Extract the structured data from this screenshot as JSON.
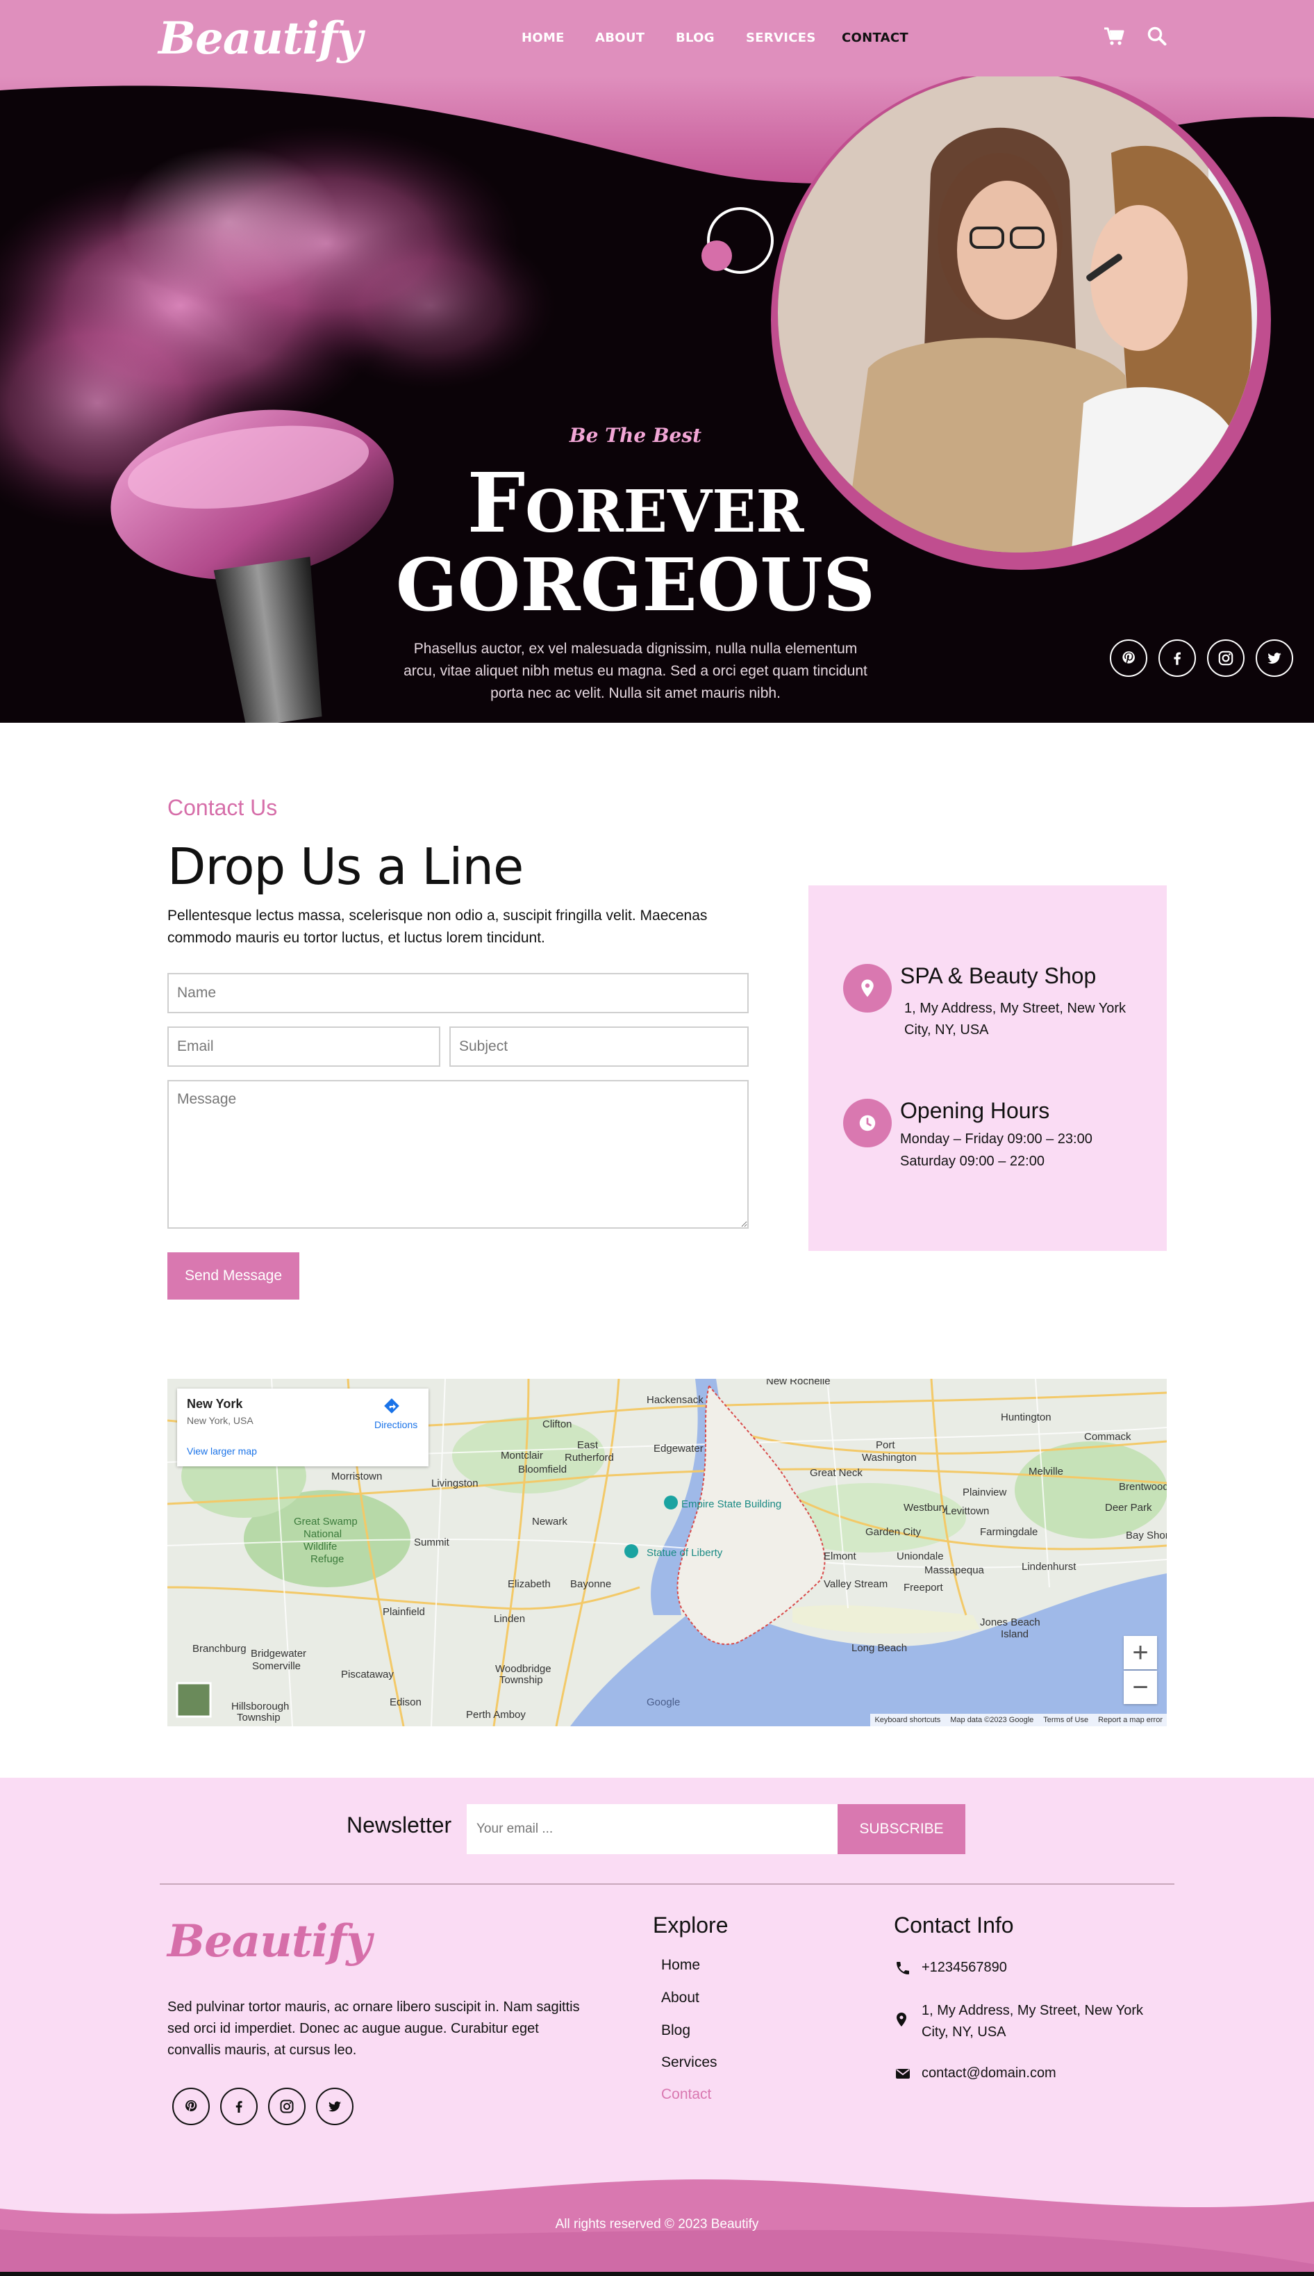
{
  "header": {
    "logo": "Beautify",
    "nav": [
      "HOME",
      "ABOUT",
      "BLOG",
      "SERVICES",
      "CONTACT"
    ],
    "active_nav": "CONTACT",
    "icons": [
      "cart-icon",
      "search-icon"
    ]
  },
  "hero": {
    "tagline": "Be The Best",
    "title_line1": "Forever",
    "title_line2": "GORGEOUS",
    "description": "Phasellus auctor, ex vel malesuada dignissim, nulla nulla elementum arcu, vitae aliquet nibh metus eu magna. Sed a orci eget quam tincidunt porta nec ac velit. Nulla sit amet mauris nibh.",
    "social": [
      "pinterest-icon",
      "facebook-icon",
      "instagram-icon",
      "twitter-icon"
    ]
  },
  "contact": {
    "label": "Contact Us",
    "heading": "Drop Us a Line",
    "description": "Pellentesque lectus massa, scelerisque non odio a, suscipit fringilla velit. Maecenas commodo mauris eu tortor luctus, et luctus lorem tincidunt.",
    "form": {
      "name_placeholder": "Name",
      "email_placeholder": "Email",
      "subject_placeholder": "Subject",
      "message_placeholder": "Message",
      "send_label": "Send Message"
    },
    "info": {
      "shop_title": "SPA & Beauty Shop",
      "shop_address": "1, My Address, My Street, New York City, NY, USA",
      "hours_title": "Opening Hours",
      "hours_weekday": "Monday – Friday 09:00 – 23:00",
      "hours_saturday": "Saturday 09:00 – 22:00"
    }
  },
  "map": {
    "card_title": "New York",
    "card_subtitle": "New York, USA",
    "directions_label": "Directions",
    "larger_map_label": "View larger map",
    "zoom_in": "+",
    "zoom_out": "−",
    "google_label": "Google",
    "footer_links": [
      "Keyboard shortcuts",
      "Map data ©2023 Google",
      "Terms of Use",
      "Report a map error"
    ],
    "place_labels": [
      "New York",
      "Newark",
      "Empire State Building",
      "Statue of Liberty",
      "Great Swamp National Wildlife Refuge",
      "Hackensack",
      "Clifton",
      "Montclair",
      "Bloomfield",
      "East Rutherford",
      "Edgewater",
      "Port Washington",
      "Great Neck",
      "Huntington",
      "Commack",
      "Melville",
      "Plainview",
      "Westbury",
      "Garden City",
      "Farmingdale",
      "Deer Park",
      "Bay Shore",
      "Brentwood",
      "Levittown",
      "Massapequa",
      "Lindenhurst",
      "Freeport",
      "Valley Stream",
      "Elmont",
      "Uniondale",
      "Jones Beach Island",
      "Long Beach",
      "Summit",
      "Livingston",
      "Morristown",
      "Plainfield",
      "Linden",
      "Elizabeth",
      "Bayonne",
      "Woodbridge Township",
      "Piscataway",
      "Edison",
      "Perth Amboy",
      "Bridgewater",
      "Somerville",
      "Branchburg",
      "Hillsborough Township",
      "New Rochelle"
    ]
  },
  "newsletter": {
    "label": "Newsletter",
    "placeholder": "Your email ...",
    "button": "SUBSCRIBE"
  },
  "footer": {
    "logo": "Beautify",
    "description": "Sed pulvinar tortor mauris, ac ornare libero suscipit in. Nam sagittis sed orci id imperdiet. Donec ac augue augue. Curabitur eget convallis mauris, at cursus leo.",
    "explore_title": "Explore",
    "explore_links": [
      "Home",
      "About",
      "Blog",
      "Services",
      "Contact"
    ],
    "active_link": "Contact",
    "contact_title": "Contact Info",
    "phone": "+1234567890",
    "address": "1, My Address, My Street, New York City, NY, USA",
    "email": "contact@domain.com",
    "copyright": "All rights reserved © 2023 Beautify"
  },
  "colors": {
    "brand_pink": "#df8fbd",
    "button_pink": "#d978b0",
    "label_pink": "#d66ea9",
    "footer_bg": "#fadcf4",
    "hero_bg": "#0b0308"
  }
}
